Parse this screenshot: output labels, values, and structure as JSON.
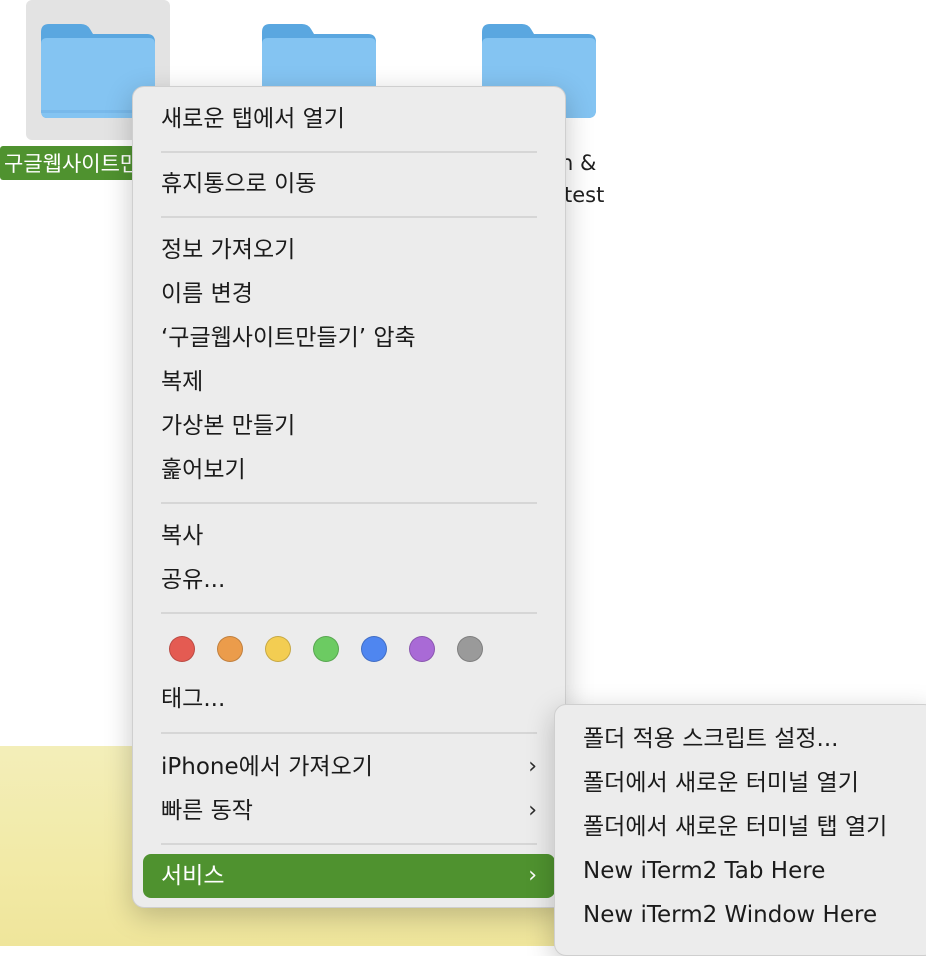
{
  "desktop": {
    "folders": [
      {
        "label": "구글웹사이트만들기",
        "selected": true
      },
      {
        "label": ""
      },
      {
        "label_line1": "n &",
        "label_line2": "test"
      }
    ]
  },
  "menu": {
    "open_new_tab": "새로운 탭에서 열기",
    "move_to_trash": "휴지통으로 이동",
    "get_info": "정보 가져오기",
    "rename": "이름 변경",
    "compress": "‘구글웹사이트만들기’ 압축",
    "duplicate": "복제",
    "make_alias": "가상본 만들기",
    "quick_look": "훑어보기",
    "copy": "복사",
    "share": "공유...",
    "tags": "태그...",
    "import_iphone": "iPhone에서 가져오기",
    "quick_actions": "빠른 동작",
    "services": "서비스",
    "chevron": "›",
    "tag_colors": [
      "#e45b52",
      "#eb9c4b",
      "#f3cd52",
      "#6ccb62",
      "#4f86f0",
      "#a96ad6",
      "#9a9a9a"
    ]
  },
  "submenu": {
    "items": [
      "폴더 적용 스크립트 설정...",
      "폴더에서 새로운 터미널 열기",
      "폴더에서 새로운 터미널 탭 열기",
      "New iTerm2 Tab Here",
      "New iTerm2 Window Here"
    ]
  }
}
